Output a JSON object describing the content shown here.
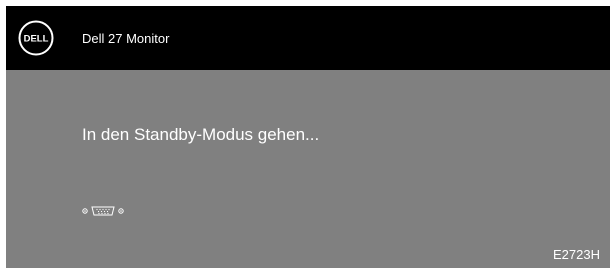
{
  "header": {
    "logo": "DELL",
    "title": "Dell 27 Monitor"
  },
  "main": {
    "message": "In den Standby-Modus gehen...",
    "input_icons": [
      "dot-icon",
      "vga-connector-icon",
      "dot-icon"
    ]
  },
  "footer": {
    "model": "E2723H"
  },
  "colors": {
    "header_background": "#000000",
    "panel_background": "#808080",
    "text": "#ffffff"
  }
}
